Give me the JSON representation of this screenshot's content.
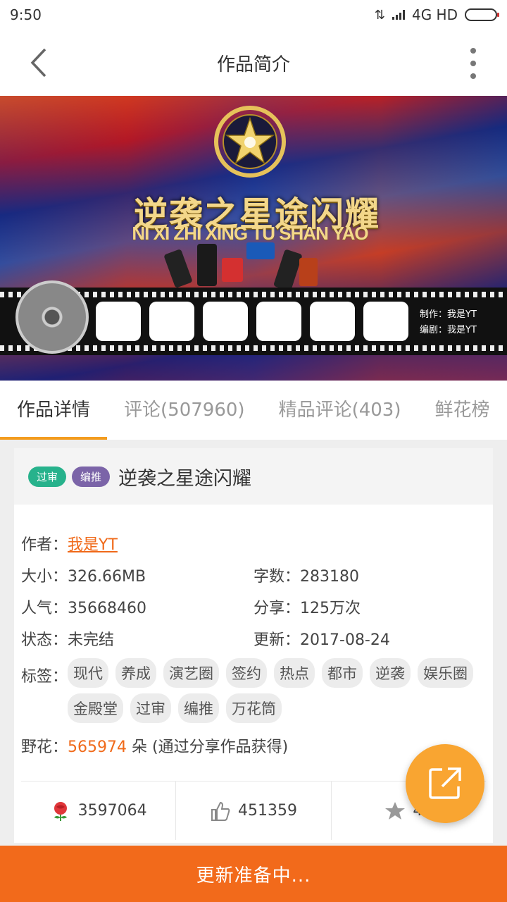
{
  "status_bar": {
    "time": "9:50",
    "network": "4G HD"
  },
  "app_bar": {
    "title": "作品简介"
  },
  "banner": {
    "title_art": "逆袭之星途闪耀",
    "pinyin": "NI XI ZHI XING TU SHAN YAO",
    "credit_producer": "制作：我是YT",
    "credit_writer": "编剧：我是YT"
  },
  "tabs": [
    {
      "label": "作品详情",
      "active": true
    },
    {
      "label": "评论(507960)",
      "active": false
    },
    {
      "label": "精品评论(403)",
      "active": false
    },
    {
      "label": "鲜花榜",
      "active": false
    }
  ],
  "book": {
    "badges": [
      "过审",
      "编推"
    ],
    "title": "逆袭之星途闪耀",
    "author_label": "作者：",
    "author": "我是YT",
    "size_label": "大小：",
    "size": "326.66MB",
    "words_label": "字数：",
    "words": "283180",
    "popularity_label": "人气：",
    "popularity": "35668460",
    "shares_label": "分享：",
    "shares": "125万次",
    "status_label": "状态：",
    "status": "未完结",
    "updated_label": "更新：",
    "updated": "2017-08-24",
    "tags_label": "标签：",
    "tags": [
      "现代",
      "养成",
      "演艺圈",
      "签约",
      "热点",
      "都市",
      "逆袭",
      "娱乐圈",
      "金殿堂",
      "过审",
      "编推",
      "万花筒"
    ],
    "flowers_label": "野花：",
    "flowers": "565974",
    "flowers_suffix": "朵 (通过分享作品获得)"
  },
  "stats": {
    "flowers": "3597064",
    "likes": "451359",
    "favorites": "40"
  },
  "bottom_button": "更新准备中...",
  "colors": {
    "accent": "#f26a1b",
    "tab_indicator": "#f39c1f",
    "fab": "#f9a531"
  }
}
